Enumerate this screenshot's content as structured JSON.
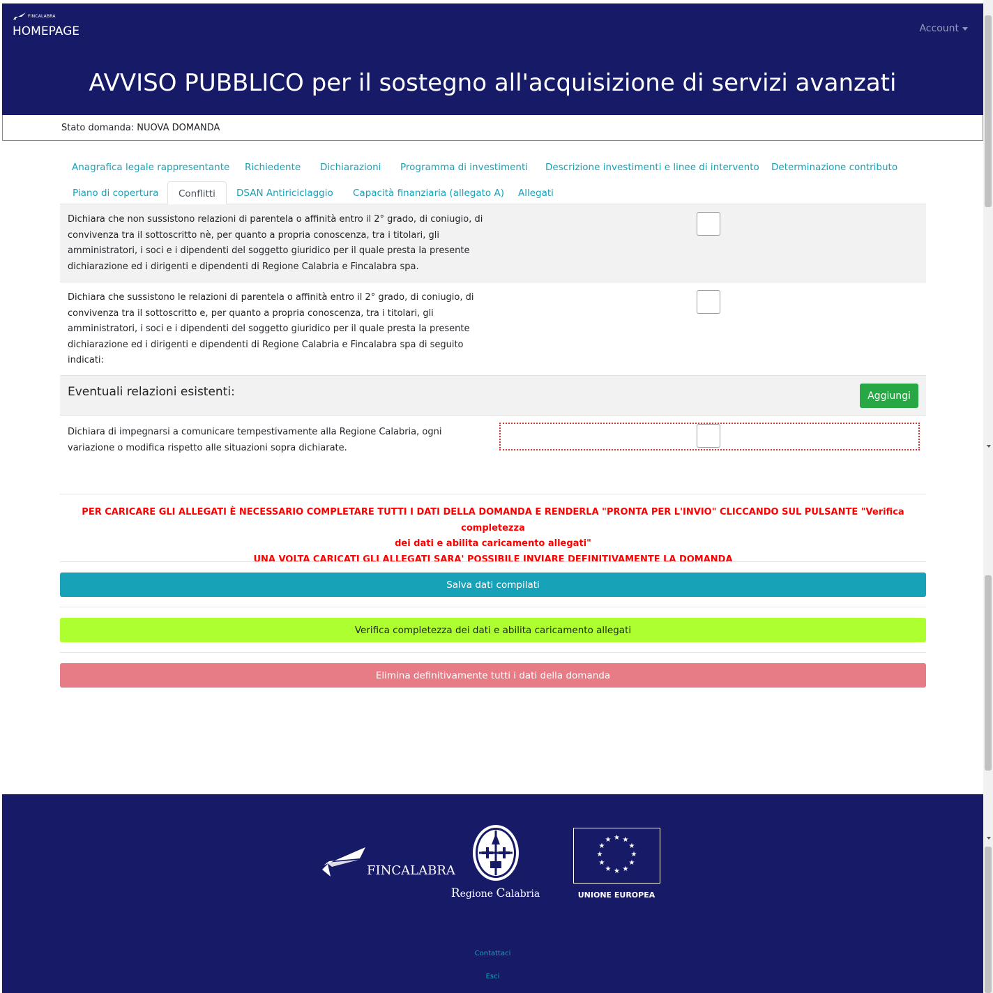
{
  "header": {
    "brand_small": "FINCALABRA",
    "brand_home": "HOMEPAGE",
    "account": "Account",
    "title": "AVVISO PUBBLICO per il sostegno all'acquisizione di servizi avanzati"
  },
  "status": {
    "text": "Stato domanda: NUOVA DOMANDA"
  },
  "tabs": [
    "Anagrafica legale rappresentante",
    "Richiedente",
    "Dichiarazioni",
    "Programma di investimenti",
    "Descrizione investimenti e linee di intervento",
    "Determinazione contributo",
    "Piano di copertura",
    "Conflitti",
    "DSAN Antiriciclaggio",
    "Capacità finanziaria (allegato A)",
    "Allegati"
  ],
  "active_tab": "Conflitti",
  "declarations": {
    "d1": [
      "Dichiara che non sussistono relazioni di parentela o affinità entro il 2° grado, di coniugio, di",
      "convivenza tra il sottoscritto nè, per quanto a propria conoscenza, tra i titolari, gli",
      "amministratori, i soci e i dipendenti del soggetto giuridico per il quale presta la presente",
      "dichiarazione ed i dirigenti e dipendenti di Regione Calabria e Fincalabra spa."
    ],
    "d2": [
      "Dichiara che sussistono le relazioni di parentela o affinità entro il 2° grado, di coniugio, di",
      "convivenza tra il sottoscritto e, per quanto a propria conoscenza, tra i titolari, gli",
      "amministratori, i soci e i dipendenti del soggetto giuridico per il quale presta la presente",
      "dichiarazione ed i dirigenti e dipendenti di Regione Calabria e Fincalabra spa di seguito",
      "indicati:"
    ],
    "section_title": "Eventuali relazioni esistenti:",
    "add_button": "Aggiungi",
    "d3": [
      "Dichiara di impegnarsi a comunicare tempestivamente alla Regione Calabria, ogni",
      "variazione o modifica rispetto alle situazioni sopra dichiarate."
    ]
  },
  "warning": [
    "PER CARICARE GLI ALLEGATI È NECESSARIO COMPLETARE TUTTI I DATI DELLA DOMANDA E RENDERLA \"PRONTA PER L'INVIO\" CLICCANDO SUL PULSANTE \"Verifica completezza",
    "dei dati e abilita caricamento allegati\"",
    "UNA VOLTA CARICATI GLI ALLEGATI SARA' POSSIBILE INVIARE DEFINITIVAMENTE LA DOMANDA"
  ],
  "buttons": {
    "save": "Salva dati compilati",
    "verify": "Verifica completezza dei dati e abilita caricamento allegati",
    "delete": "Elimina definitivamente tutti i dati della domanda"
  },
  "footer": {
    "fincalabra": "FINCALABRA",
    "regione_r": "R",
    "regione_rest": "egione ",
    "calabria_c": "C",
    "calabria_rest": "alabria",
    "eu": "UNIONE EUROPEA",
    "contact": "Contattaci",
    "exit": "Esci"
  },
  "colors": {
    "navy": "#171a66",
    "teal": "#17a2b8",
    "green": "#28a745",
    "lime": "#adff2f",
    "pink": "#e87c86",
    "red": "#ff0000"
  }
}
